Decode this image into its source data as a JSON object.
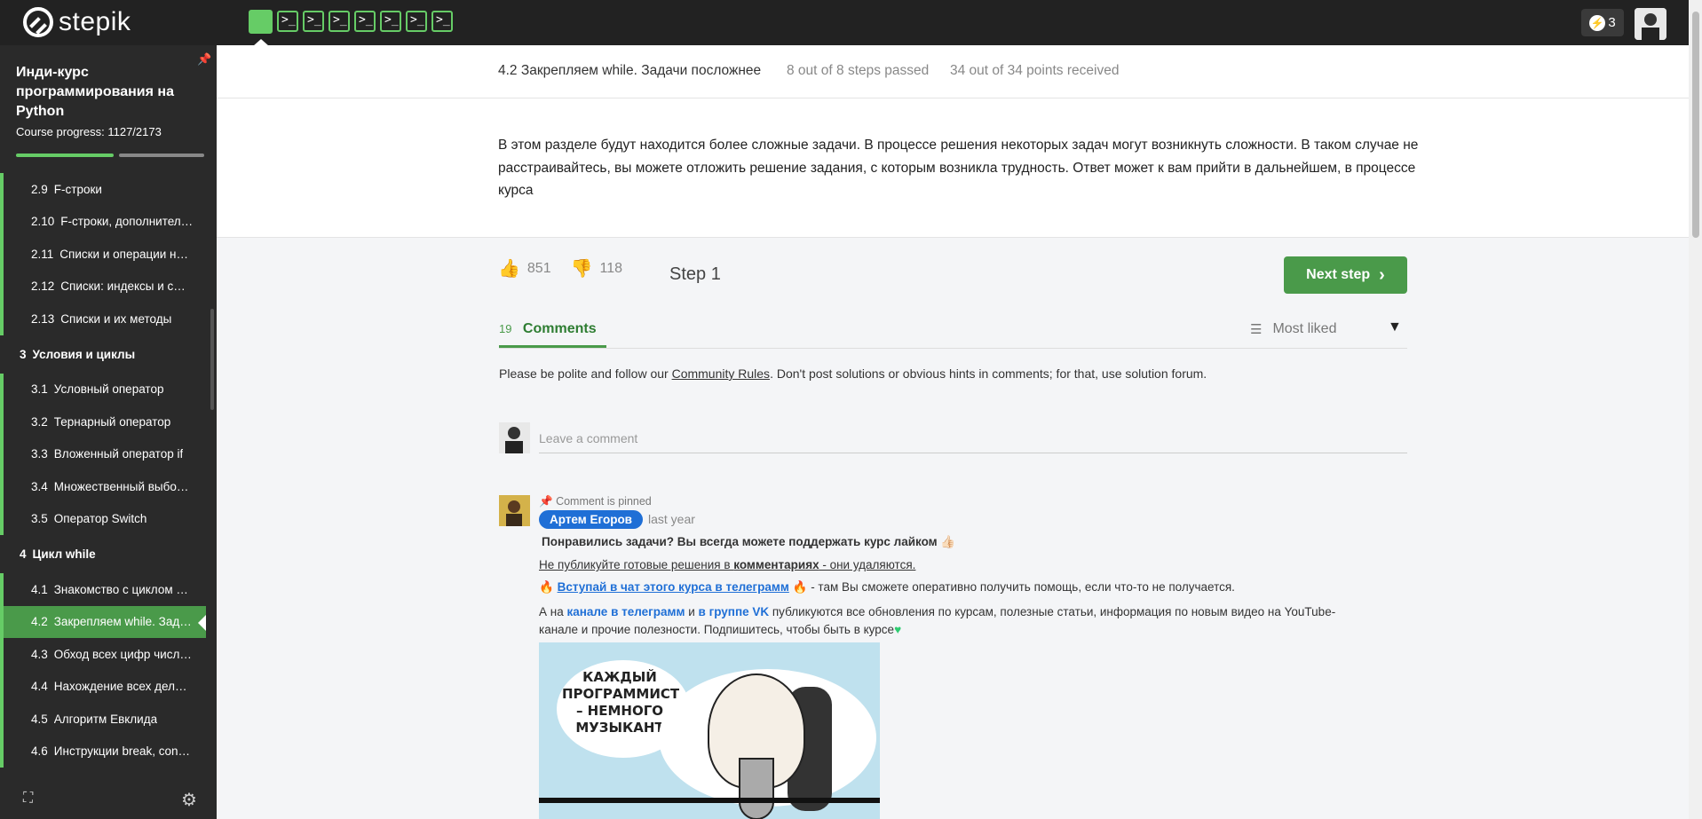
{
  "app": {
    "logo_text": "stepik"
  },
  "topbar": {
    "energy_count": "3",
    "step_count": 8
  },
  "sidebar": {
    "course_title": "Инди-курс программирования на Python",
    "progress_label": "Course progress:",
    "progress_value": "1127/2173",
    "progress_fraction": 0.518,
    "items": [
      {
        "num": "2.9",
        "label": "F-строки",
        "type": "lesson"
      },
      {
        "num": "2.10",
        "label": "F-строки, дополнител…",
        "type": "lesson"
      },
      {
        "num": "2.11",
        "label": "Списки и операции н…",
        "type": "lesson"
      },
      {
        "num": "2.12",
        "label": "Списки: индексы и с…",
        "type": "lesson"
      },
      {
        "num": "2.13",
        "label": "Списки и их методы",
        "type": "lesson"
      },
      {
        "num": "3",
        "label": "Условия и циклы",
        "type": "section"
      },
      {
        "num": "3.1",
        "label": "Условный оператор",
        "type": "lesson"
      },
      {
        "num": "3.2",
        "label": "Тернарный оператор",
        "type": "lesson"
      },
      {
        "num": "3.3",
        "label": "Вложенный оператор if",
        "type": "lesson"
      },
      {
        "num": "3.4",
        "label": "Множественный выбо…",
        "type": "lesson"
      },
      {
        "num": "3.5",
        "label": "Оператор Switch",
        "type": "lesson"
      },
      {
        "num": "4",
        "label": "Цикл while",
        "type": "section"
      },
      {
        "num": "4.1",
        "label": "Знакомство с циклом …",
        "type": "lesson"
      },
      {
        "num": "4.2",
        "label": "Закрепляем while. Зад…",
        "type": "current"
      },
      {
        "num": "4.3",
        "label": "Обход всех цифр числ…",
        "type": "lesson"
      },
      {
        "num": "4.4",
        "label": "Нахождение всех дел…",
        "type": "lesson"
      },
      {
        "num": "4.5",
        "label": "Алгоритм Евклида",
        "type": "lesson"
      },
      {
        "num": "4.6",
        "label": "Инструкции break, con…",
        "type": "lesson"
      }
    ]
  },
  "header": {
    "lesson_title": "4.2 Закрепляем while. Задачи посложнее",
    "steps_passed": "8 out of 8 steps passed",
    "points": "34 out of 34 points  received"
  },
  "intro": {
    "text": "В этом разделе будут находится более сложные задачи. В процессе решения некоторых задач могут возникнуть сложности. В таком случае не расстраивайтесь, вы можете отложить решение задания, с которым возникла трудность. Ответ может к вам прийти в дальнейшем, в процессе курса"
  },
  "step": {
    "likes": "851",
    "dislikes": "118",
    "label": "Step 1",
    "next_label": "Next step"
  },
  "comments": {
    "count": "19",
    "tab_label": "Comments",
    "sort_label": "Most liked",
    "rules_prefix": "Please be polite and follow our ",
    "rules_link": "Community Rules",
    "rules_suffix": ". Don't post solutions or obvious hints in comments; for that, use solution forum.",
    "input_placeholder": "Leave a comment",
    "pinned": {
      "pinned_label": "Comment is pinned",
      "author": "Артем Егоров",
      "time": "last year",
      "line1": "Понравились задачи? Вы всегда можете поддержать курс лайком 👍🏻",
      "line2_prefix": "Не публикуйте готовые решения в ",
      "line2_bold": "комментариях",
      "line2_suffix": " - они удаляются.",
      "line3_link": "Вступай в чат этого курса в телеграмм",
      "line3_suffix": " - там Вы сможете оперативно получить помощь, если что-то не получается.",
      "line4_a": "А на ",
      "line4_link1": "канале в телеграмм",
      "line4_and": " и ",
      "line4_link2": "в группе VK",
      "line4_rest": " публикуются все обновления по курсам, полезные статьи, информация по новым видео на YouTube-канале и прочие полезности. Подпишитесь, чтобы быть в курсе",
      "comic_text": "КАЖДЫЙ ПРОГРАММИСТ – НЕМНОГО МУЗЫКАНТ"
    }
  },
  "colors": {
    "accent": "#4a9a4a",
    "step_green": "#66cc66",
    "author_badge": "#1f6fd6",
    "topbar": "#222222",
    "sidebar": "#2a2a2a"
  }
}
